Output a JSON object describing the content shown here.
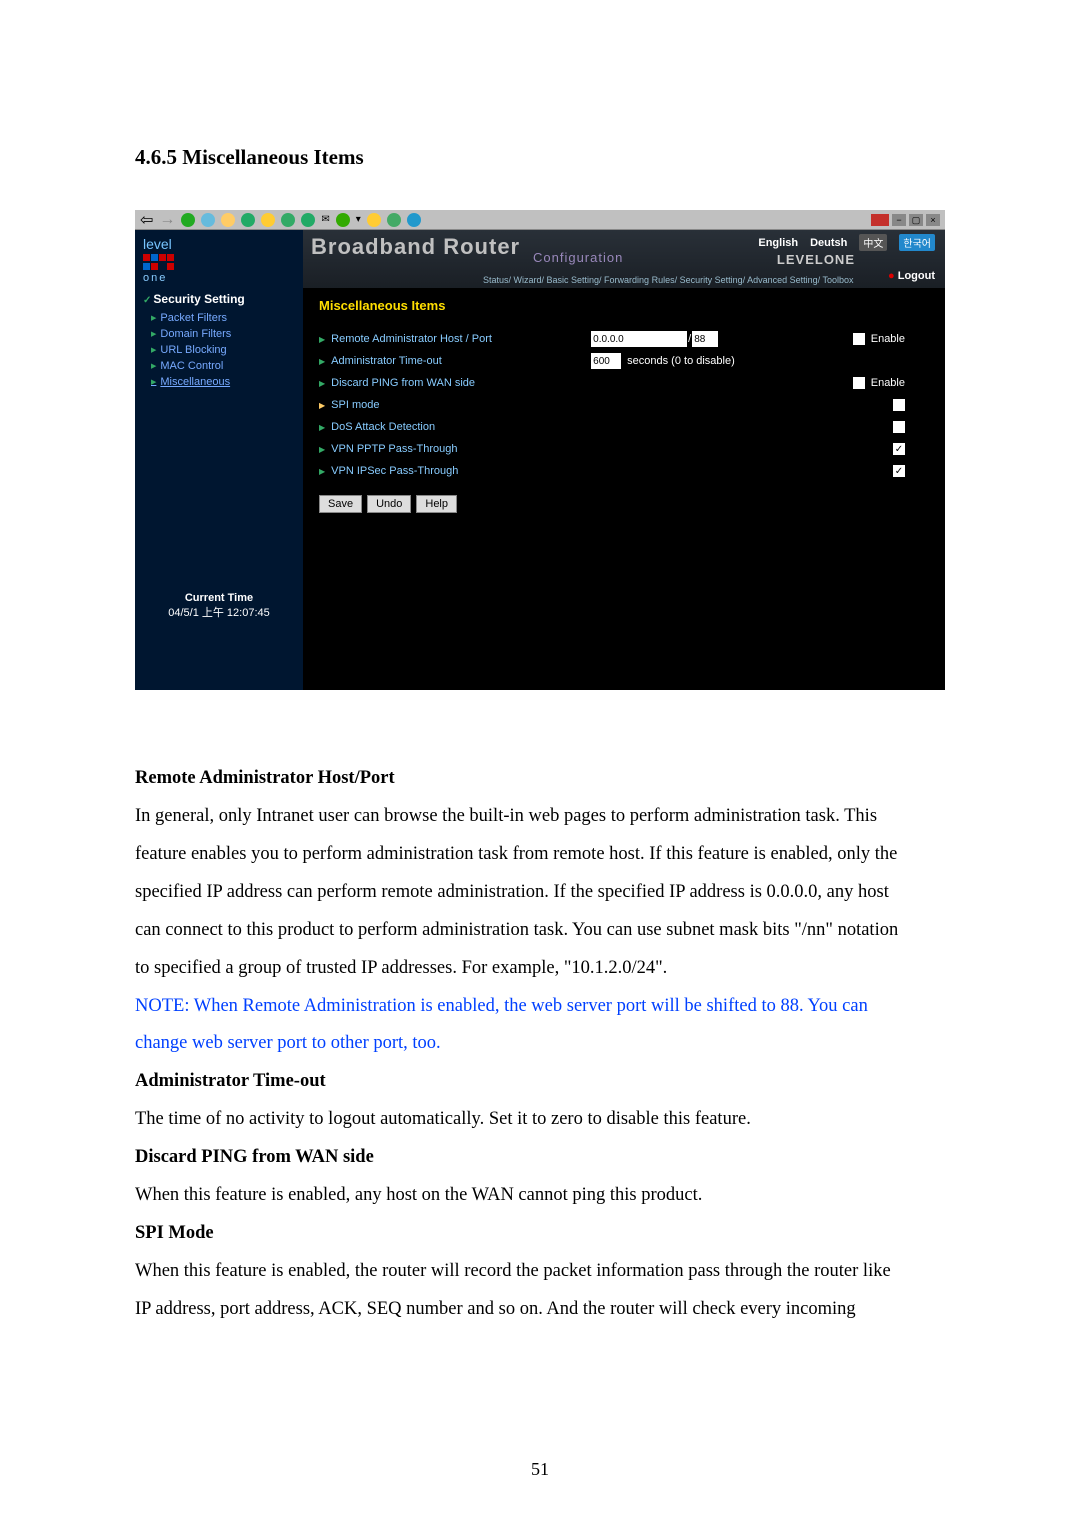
{
  "section_heading": "4.6.5 Miscellaneous Items",
  "screenshot": {
    "logo": "level",
    "one": "one",
    "nav_heading": "Security Setting",
    "nav_items": [
      "Packet Filters",
      "Domain Filters",
      "URL Blocking",
      "MAC Control",
      "Miscellaneous"
    ],
    "current_time_label": "Current Time",
    "current_time_value": "04/5/1 上午 12:07:45",
    "banner_brand": "Broadband Router",
    "banner_config": "Configuration",
    "crumbs": "Status/ Wizard/ Basic Setting/ Forwarding Rules/ Security Setting/ Advanced Setting/ Toolbox",
    "lang_en": "English",
    "lang_de": "Deutsh",
    "lang_cn": "中文",
    "lang_kr": "한국어",
    "levelone": "LEVELONE",
    "logout": "Logout",
    "content_title": "Miscellaneous Items",
    "rows": {
      "remote_admin": "Remote Administrator Host / Port",
      "ip": "0.0.0.0",
      "slash": "/",
      "port": "88",
      "enable": "Enable",
      "admin_timeout": "Administrator Time-out",
      "timeout_val": "600",
      "timeout_suffix": "seconds (0 to disable)",
      "discard_ping": "Discard PING from WAN side",
      "spi": "SPI mode",
      "dos": "DoS Attack Detection",
      "vpn_pptp": "VPN PPTP Pass-Through",
      "vpn_ipsec": "VPN IPSec Pass-Through"
    },
    "buttons": {
      "save": "Save",
      "undo": "Undo",
      "help": "Help"
    }
  },
  "doc": {
    "h1": "Remote Administrator Host/Port",
    "p1a": "In general, only Intranet user can browse the built-in web pages to perform administration task. This",
    "p1b": "feature enables you to perform administration task from remote host. If this feature is enabled, only the",
    "p1c": "specified IP address can perform remote administration. If the specified IP address is 0.0.0.0, any host",
    "p1d": "can connect to this product to perform administration task. You can use subnet mask bits \"/nn\" notation",
    "p1e": "to specified a group of trusted IP addresses. For example, \"10.1.2.0/24\".",
    "note1": "NOTE: When Remote Administration is enabled, the web server port will be shifted to 88. You can",
    "note2": "change web server port to other port, too.",
    "h2": "Administrator Time-out",
    "p2": "The time of no activity to logout automatically. Set it to zero to disable this feature.",
    "h3": "Discard PING from WAN side",
    "p3": "When this feature is enabled, any host on the WAN cannot ping this product.",
    "h4": "SPI Mode",
    "p4a": "When this feature is enabled, the router will record the packet information pass through the router like",
    "p4b": "IP address, port address, ACK, SEQ number and so on. And the router will check every incoming"
  },
  "page_number": "51"
}
